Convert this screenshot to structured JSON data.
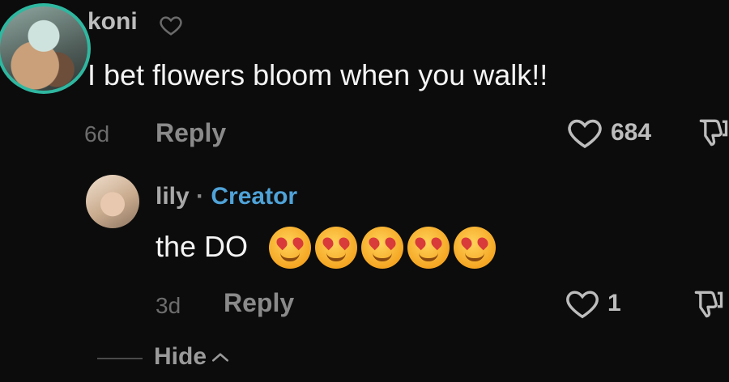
{
  "comment": {
    "username": "koni",
    "text": "I bet flowers bloom when you walk!!",
    "time": "6d",
    "reply_label": "Reply",
    "like_count": "684"
  },
  "reply": {
    "username": "lily",
    "separator": "·",
    "badge": "Creator",
    "text": "the DO",
    "emoji_name": "smiling-face-with-heart-eyes",
    "emoji_count": 5,
    "time": "3d",
    "reply_label": "Reply",
    "like_count": "1"
  },
  "hide_label": "Hide",
  "colors": {
    "background": "#0c0c0c",
    "avatar_ring": "#2fb7a0",
    "creator_badge": "#4fa3d8"
  }
}
